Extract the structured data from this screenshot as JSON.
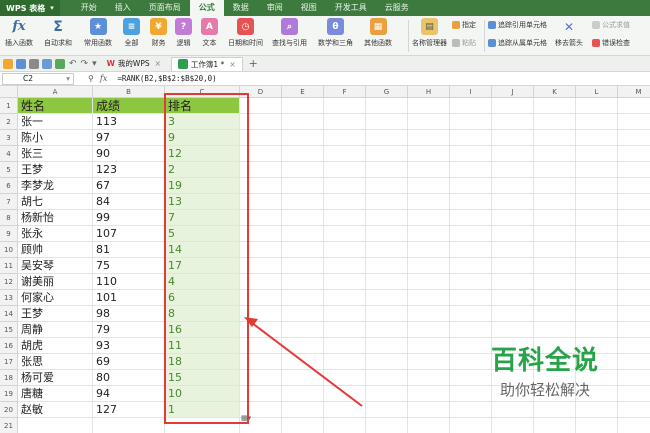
{
  "app": {
    "logo": "WPS 表格",
    "menu_tabs": [
      "开始",
      "插入",
      "页面布局",
      "公式",
      "数据",
      "审阅",
      "视图",
      "开发工具",
      "云服务"
    ],
    "active_tab": "公式"
  },
  "ribbon": {
    "insert_function": "插入函数",
    "autosum": "自动求和",
    "recent": "常用函数",
    "all": "全部",
    "finance": "财务",
    "logic": "逻辑",
    "text": "文本",
    "datetime": "日期和时间",
    "lookup": "查找与引用",
    "math": "数学和三角",
    "other": "其他函数",
    "name_manager": "名称管理器",
    "specify": "指定",
    "paste": "粘贴",
    "trace_precedents": "追踪引用单元格",
    "trace_dependents": "追踪从属单元格",
    "remove_arrows": "移去箭头",
    "show_formulas": "公式求值",
    "error_check": "错误检查"
  },
  "tabs": {
    "mywps": "我的WPS",
    "doc": "工作簿1 *"
  },
  "formula_bar": {
    "cell_ref": "C2",
    "formula": "=RANK(B2,$B$2:$B$20,0)"
  },
  "columns": [
    "A",
    "B",
    "C",
    "D",
    "E",
    "F",
    "G",
    "H",
    "I",
    "J",
    "K",
    "L",
    "M"
  ],
  "rows": [
    [
      "姓名",
      "成绩",
      "排名"
    ],
    [
      "张一",
      "113",
      "3"
    ],
    [
      "陈小",
      "97",
      "9"
    ],
    [
      "张三",
      "90",
      "12"
    ],
    [
      "王梦",
      "123",
      "2"
    ],
    [
      "李梦龙",
      "67",
      "19"
    ],
    [
      "胡七",
      "84",
      "13"
    ],
    [
      "杨新怡",
      "99",
      "7"
    ],
    [
      "张永",
      "107",
      "5"
    ],
    [
      "顾帅",
      "81",
      "14"
    ],
    [
      "吴安琴",
      "75",
      "17"
    ],
    [
      "谢美丽",
      "110",
      "4"
    ],
    [
      "何家心",
      "101",
      "6"
    ],
    [
      "王梦",
      "98",
      "8"
    ],
    [
      "周静",
      "79",
      "16"
    ],
    [
      "胡虎",
      "93",
      "11"
    ],
    [
      "张思",
      "69",
      "18"
    ],
    [
      "杨可爱",
      "80",
      "15"
    ],
    [
      "唐糖",
      "94",
      "10"
    ],
    [
      "赵敏",
      "127",
      "1"
    ],
    [
      "",
      "",
      ""
    ],
    [
      "",
      "",
      ""
    ]
  ],
  "watermark": {
    "line1": "百科全说",
    "line2": "助你轻松解决"
  }
}
